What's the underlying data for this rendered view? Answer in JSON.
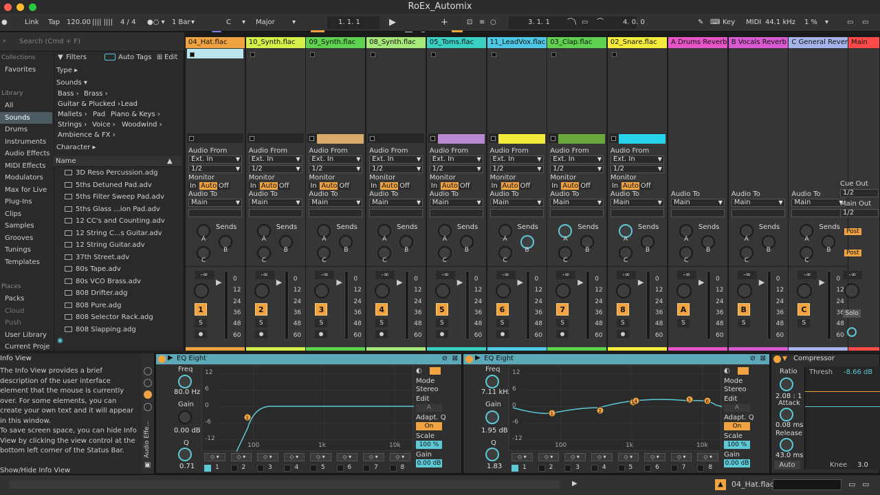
{
  "window": {
    "title": "RoEx_Automix"
  },
  "control_bar": {
    "link": "Link",
    "tap": "Tap",
    "tempo": "120.00",
    "signature": "4 / 4",
    "quantize": "1 Bar",
    "key": "C",
    "scale": "Major",
    "position": "1.   1.   1",
    "loop_start": "3.   1.   1",
    "loop_length": "4.   0.   0",
    "key_label": "Key",
    "midi_label": "MIDI",
    "sample_rate": "44.1 kHz",
    "cpu": "1 %"
  },
  "browser": {
    "search_placeholder": "Search (Cmd + F)",
    "collections_label": "Collections",
    "favorites": "Favorites",
    "library_label": "Library",
    "places_label": "Places",
    "library_items": [
      "All",
      "Sounds",
      "Drums",
      "Instruments",
      "Audio Effects",
      "MIDI Effects",
      "Modulators",
      "Max for Live",
      "Plug-Ins",
      "Clips",
      "Samples",
      "Grooves",
      "Tunings",
      "Templates"
    ],
    "selected_item": "Sounds",
    "place_items": [
      "Packs",
      "Cloud",
      "Push",
      "User Library",
      "Current Proje"
    ],
    "filters": "Filters",
    "auto_tags": "Auto Tags",
    "edit": "Edit",
    "type_label": "Type ▸",
    "sounds_label": "Sounds ▾",
    "character_label": "Character ▸",
    "tags_row1": [
      "Bass ›",
      "Brass ›"
    ],
    "tags_row2": [
      "Guitar & Plucked ›",
      "Lead"
    ],
    "tags_row3": [
      "Mallets ›",
      "Pad",
      "Piano & Keys ›"
    ],
    "tags_row4": [
      "Strings ›",
      "Voice ›",
      "Woodwind ›"
    ],
    "tags_row5": [
      "Ambience & FX ›"
    ],
    "name_header": "Name",
    "files": [
      "3D Reso Percussion.adg",
      "5ths Detuned Pad.adv",
      "5ths Filter Sweep Pad.adv",
      "5ths Glass ...ion Pad.adv",
      "12 CC's and Counting.adv",
      "12 String C...s Guitar.adv",
      "12 String Guitar.adv",
      "37th Street.adv",
      "80s Tape.adv",
      "80s VCO Brass.adv",
      "808 Drifter.adg",
      "808 Pure.adg",
      "808 Selector Rack.adg",
      "808 Slapping.adg"
    ]
  },
  "tracks": [
    {
      "name": "04_Hat.flac",
      "color": "#f0a340",
      "num": "1",
      "clip_color": "#b9e6ee",
      "clip": "top",
      "sendA_act": false,
      "sendB_act": false
    },
    {
      "name": "10_Synth.flac",
      "color": "#d4f04a",
      "num": "2",
      "clip_color": "",
      "clip": "none",
      "sendA_act": false,
      "sendB_act": false
    },
    {
      "name": "09_Synth.flac",
      "color": "#5ed24e",
      "num": "3",
      "clip_color": "#d9a96a",
      "clip": "bottom",
      "sendA_act": false,
      "sendB_act": false
    },
    {
      "name": "08_Synth.flac",
      "color": "#a7e87a",
      "num": "4",
      "clip_color": "",
      "clip": "none",
      "sendA_act": false,
      "sendB_act": false
    },
    {
      "name": "05_Toms.flac",
      "color": "#39d0c3",
      "num": "5",
      "clip_color": "#b889d2",
      "clip": "bottom",
      "sendA_act": false,
      "sendB_act": false
    },
    {
      "name": "11_LeadVox.flac",
      "color": "#4fc8e6",
      "num": "6",
      "clip_color": "#f4ec3c",
      "clip": "bottom",
      "sendA_act": false,
      "sendB_act": true
    },
    {
      "name": "03_Clap.flac",
      "color": "#5ed24e",
      "num": "7",
      "clip_color": "#6aa83e",
      "clip": "bottom",
      "sendA_act": true,
      "sendB_act": false
    },
    {
      "name": "02_Snare.flac",
      "color": "#f4ec3c",
      "num": "8",
      "clip_color": "#27d3ea",
      "clip": "bottom",
      "sendA_act": true,
      "sendB_act": false
    }
  ],
  "returns": [
    {
      "name": "A Drums Reverb",
      "color": "#e655c8",
      "num": "A"
    },
    {
      "name": "B Vocals Reverb",
      "color": "#d85ad0",
      "num": "B"
    },
    {
      "name": "C General Reverb",
      "color": "#a6b4ea",
      "num": "C"
    }
  ],
  "master": {
    "name": "Main",
    "color": "#ff4a4a",
    "cue_out": "Cue Out",
    "cue_val": "1/2",
    "main_out": "Main Out",
    "main_val": "1/2",
    "post": "Post",
    "solo": "Solo"
  },
  "io": {
    "audio_from": "Audio From",
    "ext_in": "Ext. In",
    "channel": "1/2",
    "monitor": "Monitor",
    "in": "In",
    "auto": "Auto",
    "off": "Off",
    "audio_to": "Audio To",
    "main": "Main",
    "sends": "Sends",
    "send_a": "A",
    "send_b": "B",
    "send_c": "C",
    "vol": "-∞",
    "solo": "S"
  },
  "meter_scale": [
    "0",
    "12",
    "24",
    "36",
    "48",
    "60"
  ],
  "info_view": {
    "title": "Info View",
    "text": "The Info View provides a brief description of the user interface element that the mouse is currently over. For some elements, you can create your own text and it will appear in this window.",
    "text2": "To save screen space, you can hide Info View by clicking the view control at the bottom left corner of the Status Bar.",
    "shortcut": "Show/Hide Info View"
  },
  "eq1": {
    "title": "EQ Eight",
    "freq_label": "Freq",
    "freq": "80.0 Hz",
    "gain_label": "Gain",
    "gain": "0.00 dB",
    "q_label": "Q",
    "q": "0.71",
    "mode_label": "Mode",
    "mode": "Stereo",
    "edit_label": "Edit",
    "edit_val": "A",
    "adapt_label": "Adapt. Q",
    "adapt": "On",
    "scale_label": "Scale",
    "scale": "100 %",
    "gain_out_label": "Gain",
    "gain_out": "0.00 dB",
    "y_labels": [
      "12",
      "6",
      "0",
      "-6",
      "-12"
    ],
    "x_labels": [
      "100",
      "1k",
      "10k"
    ],
    "bands": [
      "1",
      "2",
      "3",
      "4",
      "5",
      "6",
      "7",
      "8"
    ]
  },
  "eq2": {
    "title": "EQ Eight",
    "freq_label": "Freq",
    "freq": "7.11 kHz",
    "gain_label": "Gain",
    "gain": "1.95 dB",
    "q_label": "Q",
    "q": "1.83",
    "mode_label": "Mode",
    "mode": "Stereo",
    "edit_label": "Edit",
    "edit_val": "A",
    "adapt_label": "Adapt. Q",
    "adapt": "On",
    "scale_label": "Scale",
    "scale": "100 %",
    "gain_out_label": "Gain",
    "gain_out": "0.00 dB",
    "y_labels": [
      "12",
      "6",
      "0",
      "-6",
      "-12"
    ],
    "x_labels": [
      "100",
      "1k",
      "10k"
    ],
    "bands": [
      "1",
      "2",
      "3",
      "4",
      "5",
      "6",
      "7",
      "8"
    ]
  },
  "compressor": {
    "title": "Compressor",
    "ratio_label": "Ratio",
    "ratio": "2.08 : 1",
    "attack_label": "Attack",
    "attack": "0.08 ms",
    "release_label": "Release",
    "release": "43.0 ms",
    "auto": "Auto",
    "thresh_label": "Thresh",
    "thresh": "-8.66 dB",
    "knee_label": "Knee",
    "knee": "3.0"
  },
  "audio_effects_label": "Audio Effe...",
  "status_bar": {
    "selected_track": "04_Hat.flac"
  }
}
